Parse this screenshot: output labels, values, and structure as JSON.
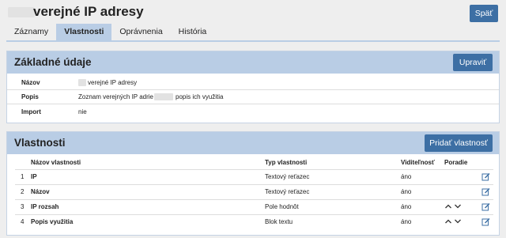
{
  "header": {
    "title": "verejné IP adresy",
    "back_label": "Späť"
  },
  "tabs": [
    {
      "label": "Záznamy"
    },
    {
      "label": "Vlastnosti"
    },
    {
      "label": "Oprávnenia"
    },
    {
      "label": "História"
    }
  ],
  "basic": {
    "heading": "Základné údaje",
    "edit_label": "Upraviť",
    "rows": [
      {
        "label": "Názov",
        "value": "verejné IP adresy"
      },
      {
        "label": "Popis",
        "value_before": "Zoznam verejných IP adrie",
        "value_after": "popis ich využitia"
      },
      {
        "label": "Import",
        "value": "nie"
      }
    ]
  },
  "props": {
    "heading": "Vlastnosti",
    "add_label": "Pridať vlastnosť",
    "columns": {
      "name": "Názov vlastnosti",
      "type": "Typ vlastnosti",
      "visible": "Viditeľnosť",
      "order": "Poradie"
    },
    "rows": [
      {
        "num": "1",
        "name": "IP",
        "type": "Textový reťazec",
        "visible": "áno"
      },
      {
        "num": "2",
        "name": "Názov",
        "type": "Textový reťazec",
        "visible": "áno"
      },
      {
        "num": "3",
        "name": "IP rozsah",
        "type": "Pole hodnôt",
        "visible": "áno"
      },
      {
        "num": "4",
        "name": "Popis využitia",
        "type": "Blok textu",
        "visible": "áno"
      }
    ]
  },
  "colors": {
    "accent": "#3d6fa4",
    "panel_header": "#b9cde5"
  }
}
